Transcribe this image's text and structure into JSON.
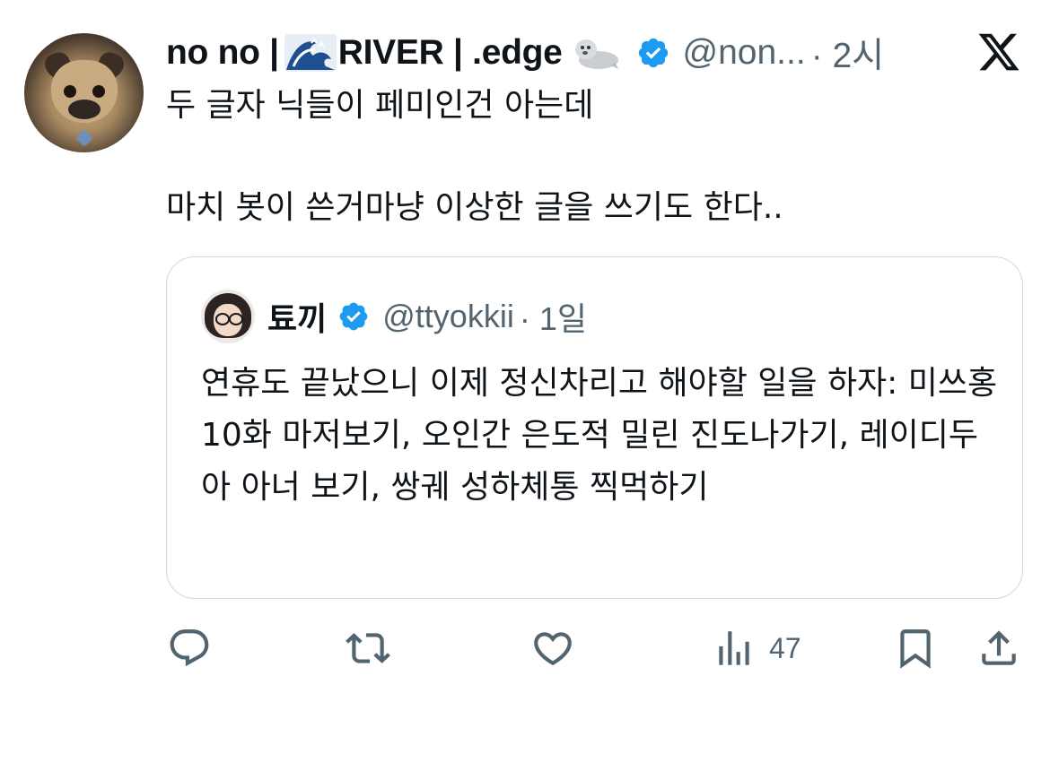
{
  "tweet": {
    "author_name": "no no |",
    "author_river": "RIVER | .edge",
    "author_emojis": [
      "wave-emoji",
      "seal-emoji"
    ],
    "handle": "@non...",
    "time": "· 2시",
    "text_line1": "두 글자 닉들이 페미인건 아는데",
    "text_line2": "마치 봇이 쓴거마냥 이상한 글을 쓰기도 한다.."
  },
  "quote": {
    "author_name": "툐끼",
    "handle": "@ttyokkii",
    "time": "· 1일",
    "text": "연휴도 끝났으니 이제 정신차리고 해야할 일을 하자: 미쓰홍 10화 마저보기, 오인간 은도적 밀린 진도나가기, 레이디두아 아너 보기, 쌍궤 성하체통 찍먹하기"
  },
  "actions": {
    "views_count": "47"
  },
  "colors": {
    "text": "#0f1419",
    "secondary": "#536471",
    "verified": "#1d9bf0",
    "border": "#cfd9de"
  },
  "icons": [
    "x-logo-icon",
    "verified-icon",
    "reply-icon",
    "retweet-icon",
    "like-icon",
    "views-icon",
    "bookmark-icon",
    "share-icon"
  ]
}
